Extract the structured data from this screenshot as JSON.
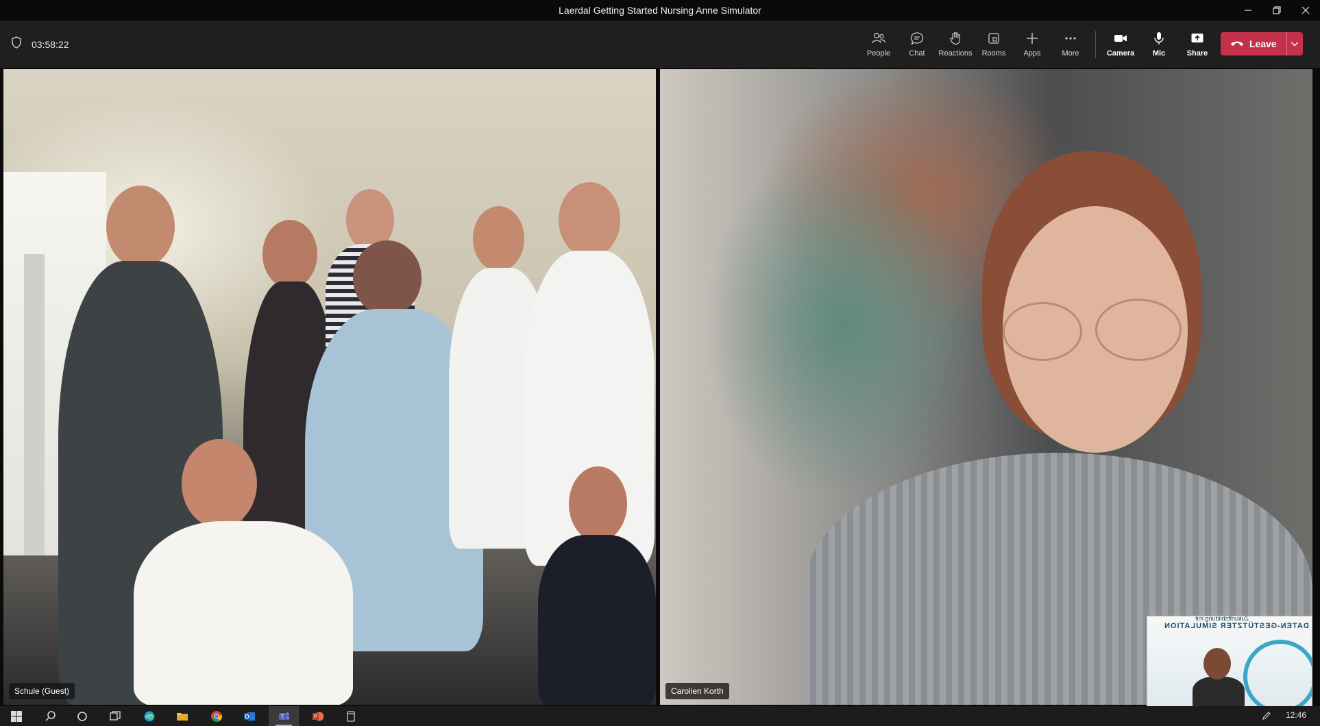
{
  "window": {
    "title": "Laerdal Getting Started Nursing Anne Simulator"
  },
  "meeting": {
    "elapsed": "03:58:22"
  },
  "toolbar": {
    "people": "People",
    "chat": "Chat",
    "reactions": "Reactions",
    "rooms": "Rooms",
    "apps": "Apps",
    "more": "More",
    "camera": "Camera",
    "mic": "Mic",
    "share": "Share",
    "leave": "Leave",
    "leave_color": "#c4314b"
  },
  "participants": [
    {
      "name": "Schule (Guest)"
    },
    {
      "name": "Carolien Korth"
    }
  ],
  "shared_screen": {
    "title": "DATEN-GESTÜTZTER SIMULATION",
    "subtitle": "Zukunftsbildung mit"
  },
  "taskbar": {
    "apps": [
      "windows-start-icon",
      "search-icon",
      "cortana-icon",
      "task-view-icon",
      "edge-icon",
      "file-explorer-icon",
      "chrome-icon",
      "outlook-icon",
      "teams-icon",
      "powerpoint-icon",
      "app-icon"
    ],
    "active": "teams-icon",
    "clock": "12:46"
  }
}
